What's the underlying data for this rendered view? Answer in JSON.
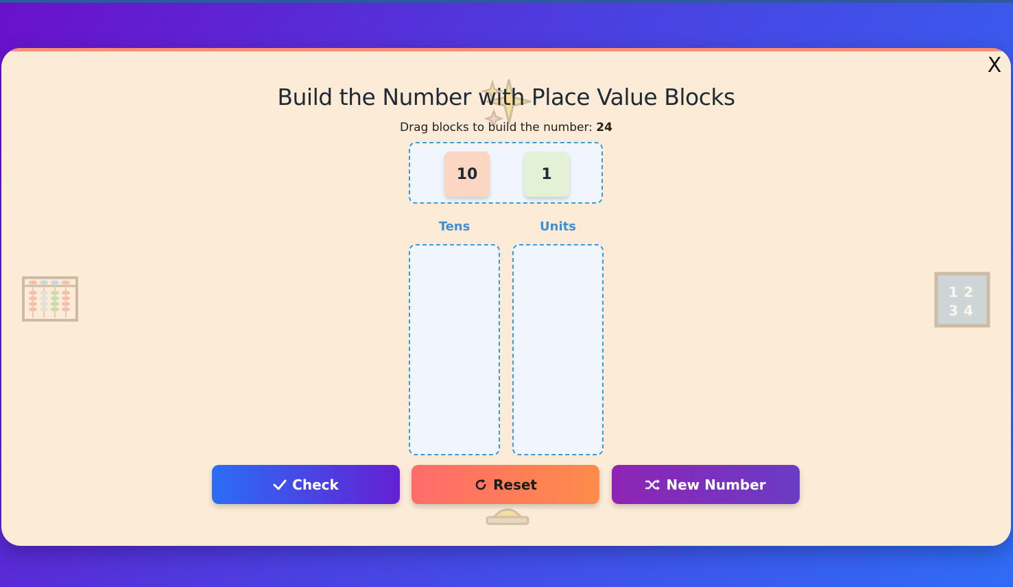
{
  "modal": {
    "close_label": "X",
    "title": "Build the Number with Place Value Blocks",
    "subtitle_prefix": "Drag blocks to build the number:",
    "target_number": "24"
  },
  "tray": {
    "blocks": [
      {
        "label": "10",
        "color": "#fbd6c3"
      },
      {
        "label": "1",
        "color": "#e3f1d6"
      }
    ]
  },
  "columns": [
    {
      "label": "Tens"
    },
    {
      "label": "Units"
    }
  ],
  "buttons": {
    "check": {
      "label": "Check",
      "icon": "check-icon"
    },
    "reset": {
      "label": "Reset",
      "icon": "rotate-icon"
    },
    "new_number": {
      "label": "New Number",
      "icon": "shuffle-icon"
    }
  },
  "decorations": {
    "right_grid": [
      "1",
      "2",
      "3",
      "4"
    ]
  },
  "colors": {
    "accent_blue": "#3b9ad9",
    "modal_bg": "#fbebd7"
  }
}
